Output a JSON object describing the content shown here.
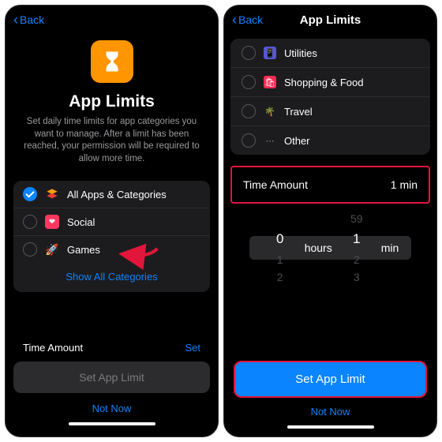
{
  "left": {
    "back": "Back",
    "title": "App Limits",
    "subtitle": "Set daily time limits for app categories you want to manage. After a limit has been reached, your permission will be required to allow more time.",
    "categories": [
      {
        "label": "All Apps & Categories",
        "checked": true,
        "icon": "stack"
      },
      {
        "label": "Social",
        "checked": false,
        "icon": "social"
      },
      {
        "label": "Games",
        "checked": false,
        "icon": "games"
      }
    ],
    "show_all": "Show All Categories",
    "time_label": "Time Amount",
    "time_action": "Set",
    "set_button": "Set App Limit",
    "not_now": "Not Now"
  },
  "right": {
    "back": "Back",
    "title": "App Limits",
    "categories": [
      {
        "label": "Utilities",
        "icon": "utilities",
        "bg": "#5856d6"
      },
      {
        "label": "Shopping & Food",
        "icon": "shopping",
        "bg": "#ff2d55"
      },
      {
        "label": "Travel",
        "icon": "travel",
        "bg": "#30d158"
      },
      {
        "label": "Other",
        "icon": "other",
        "bg": "#8e8e93"
      }
    ],
    "time_label": "Time Amount",
    "time_value": "1 min",
    "picker": {
      "hours_value": "0",
      "hours_label": "hours",
      "min_value": "1",
      "min_label": "min",
      "above_min": "59",
      "above_hour": "",
      "below_hours": [
        "1",
        "2"
      ],
      "below_mins": [
        "2",
        "3"
      ]
    },
    "set_button": "Set App Limit",
    "not_now": "Not Now"
  }
}
